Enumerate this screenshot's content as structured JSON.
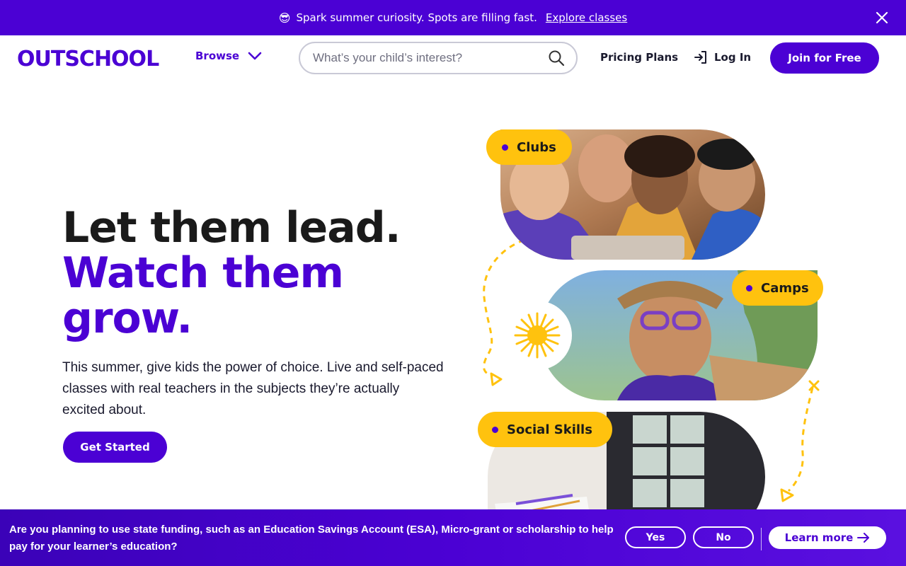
{
  "colors": {
    "brand": "#4B01D4",
    "accent_yellow": "#FFC20E",
    "text_dark": "#1a1a1a"
  },
  "promo": {
    "emoji": "😎",
    "text": "Spark summer curiosity. Spots are filling fast.",
    "link": "Explore classes",
    "close_icon": "close-icon"
  },
  "header": {
    "logo": "OUTSCHOOL",
    "browse_label": "Browse",
    "search_placeholder": "What’s your child’s interest?",
    "pricing_label": "Pricing Plans",
    "login_label": "Log In",
    "join_label": "Join for Free"
  },
  "hero": {
    "title_line1": "Let them lead.",
    "title_line2": "Watch them",
    "title_line3": "grow.",
    "subtitle": "This summer, give kids the power of choice. Live and self-paced classes with real teachers in the subjects they’re actually excited about.",
    "cta_label": "Get Started"
  },
  "collage": {
    "tags": [
      "Clubs",
      "Camps",
      "Social Skills"
    ]
  },
  "esa_bar": {
    "text": "Are you planning to use state funding, such as an Education Savings Account (ESA), Micro-grant or scholarship to help pay for your learner’s education?",
    "yes_label": "Yes",
    "no_label": "No",
    "learn_label": "Learn more"
  }
}
